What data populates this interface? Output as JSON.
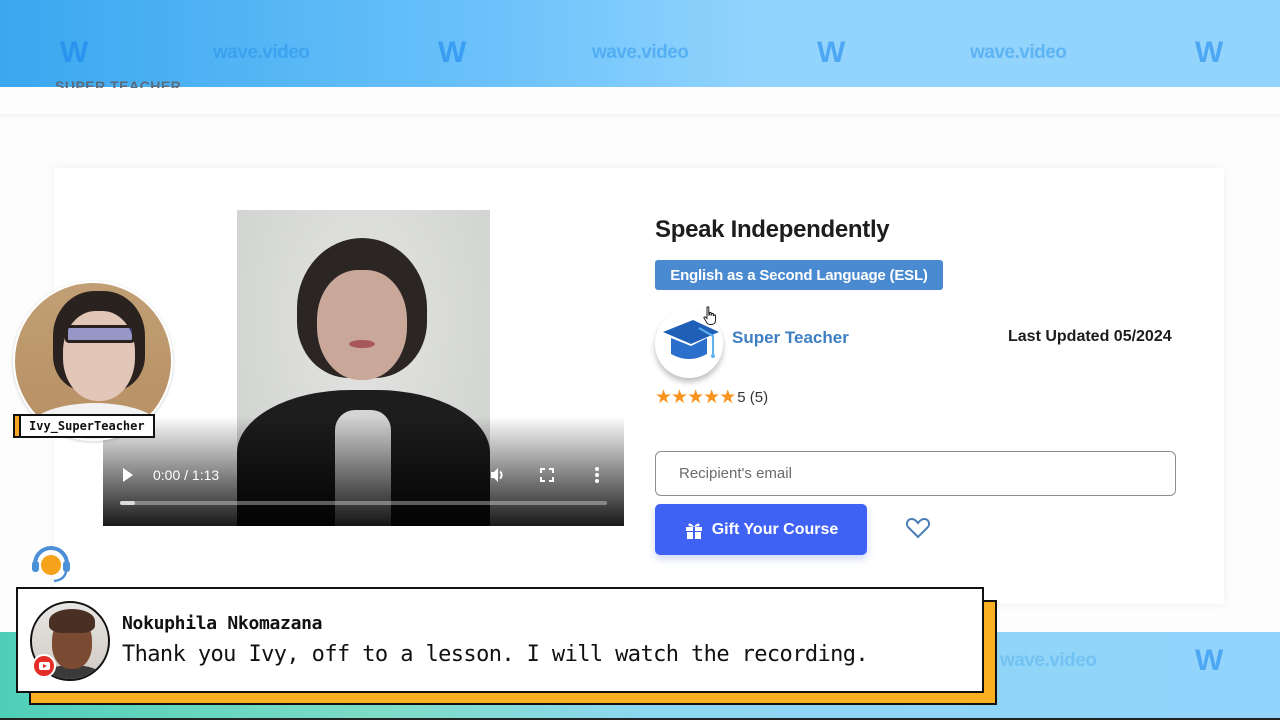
{
  "banner": {
    "watermark_text": "wave.video",
    "watermark_logo": "W"
  },
  "site": {
    "logo_text": "SUPER TEACHER"
  },
  "video": {
    "time_display": "0:00 / 1:13",
    "progress": 0.03,
    "controls": [
      "play-icon",
      "volume-icon",
      "fullscreen-icon",
      "more-options-icon"
    ]
  },
  "course": {
    "title": "Speak Independently",
    "category": "English as a Second Language (ESL)",
    "teacher_name": "Super Teacher",
    "last_updated": "Last Updated 05/2024",
    "rating_value": 5,
    "rating_max": 5,
    "rating_label": "5 (5)",
    "email_placeholder": "Recipient's email",
    "email_value": "",
    "gift_button_label": "Gift Your Course"
  },
  "webcam": {
    "name_tag": "Ivy_SuperTeacher"
  },
  "comment": {
    "author": "Nokuphila Nkomazana",
    "text": "Thank you Ivy, off to a lesson. I will watch the recording.",
    "platform": "youtube"
  },
  "colors": {
    "accent_blue": "#3f62f5",
    "badge_blue": "#4a8ad0",
    "teacher_blue": "#3e7fc2",
    "star_orange": "#f7931e",
    "comment_shadow": "#fbb021"
  }
}
